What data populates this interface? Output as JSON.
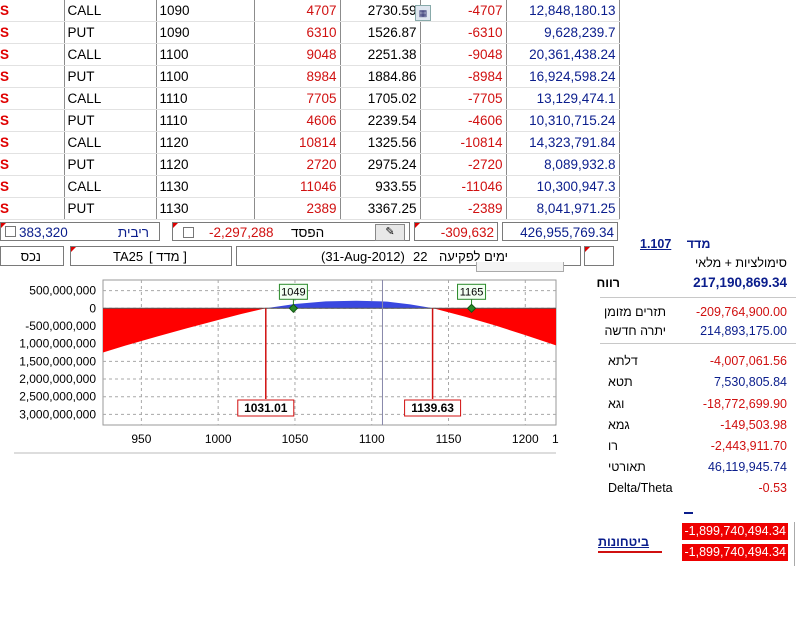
{
  "rows": [
    {
      "type": "CALL",
      "strike": "1090",
      "qty": "4707",
      "price": "2730.59",
      "neg_qty": "-4707",
      "value": "12,848,180.13"
    },
    {
      "type": "PUT",
      "strike": "1090",
      "qty": "6310",
      "price": "1526.87",
      "neg_qty": "-6310",
      "value": "9,628,239.7"
    },
    {
      "type": "CALL",
      "strike": "1100",
      "qty": "9048",
      "price": "2251.38",
      "neg_qty": "-9048",
      "value": "20,361,438.24"
    },
    {
      "type": "PUT",
      "strike": "1100",
      "qty": "8984",
      "price": "1884.86",
      "neg_qty": "-8984",
      "value": "16,924,598.24"
    },
    {
      "type": "CALL",
      "strike": "1110",
      "qty": "7705",
      "price": "1705.02",
      "neg_qty": "-7705",
      "value": "13,129,474.1"
    },
    {
      "type": "PUT",
      "strike": "1110",
      "qty": "4606",
      "price": "2239.54",
      "neg_qty": "-4606",
      "value": "10,310,715.24"
    },
    {
      "type": "CALL",
      "strike": "1120",
      "qty": "10814",
      "price": "1325.56",
      "neg_qty": "-10814",
      "value": "14,323,791.84"
    },
    {
      "type": "PUT",
      "strike": "1120",
      "qty": "2720",
      "price": "2975.24",
      "neg_qty": "-2720",
      "value": "8,089,932.8"
    },
    {
      "type": "CALL",
      "strike": "1130",
      "qty": "11046",
      "price": "933.55",
      "neg_qty": "-11046",
      "value": "10,300,947.3"
    },
    {
      "type": "PUT",
      "strike": "1130",
      "qty": "2389",
      "price": "3367.25",
      "neg_qty": "-2389",
      "value": "8,041,971.25"
    }
  ],
  "row_prefix": "S",
  "summary": {
    "interest_value": "383,320",
    "interest_label": "ריבית",
    "loss_value": "-2,297,288",
    "loss_label": "הפסד",
    "neg_total": "-309,632",
    "total_value": "426,955,769.34"
  },
  "header": {
    "assets_label": "נכס",
    "index_name": "TA25",
    "index_label": "[ מדד ]",
    "expiry_date": "(31-Aug-2012)",
    "days_to_expiry": "22",
    "days_label": "ימים לפקיעה"
  },
  "chart_data": {
    "type": "area",
    "y_tick_labels": [
      "500,000,000",
      "0",
      "-500,000,000",
      "1,000,000,000",
      "1,500,000,000",
      "2,000,000,000",
      "2,500,000,000",
      "3,000,000,000"
    ],
    "y_ticks": [
      500000000,
      0,
      -500000000,
      -1000000000,
      -1500000000,
      -2000000000,
      -2500000000,
      -3000000000
    ],
    "x_ticks": [
      950,
      1000,
      1050,
      1100,
      1150,
      1200
    ],
    "xlim": [
      925,
      1220
    ],
    "ylim": [
      -3300000000,
      800000000
    ],
    "profit_curve": {
      "x": [
        925,
        940,
        960,
        980,
        1000,
        1015,
        1031,
        1050,
        1070,
        1090,
        1110,
        1125,
        1140,
        1160,
        1180,
        1200,
        1220
      ],
      "y": [
        -1250000000,
        -1050000000,
        -800000000,
        -560000000,
        -330000000,
        -160000000,
        0,
        120000000,
        195000000,
        215000000,
        190000000,
        110000000,
        0,
        -230000000,
        -480000000,
        -760000000,
        -1050000000
      ]
    },
    "current_index": 1107,
    "breakeven": [
      {
        "x": 1031.01,
        "label": "1031.01"
      },
      {
        "x": 1139.63,
        "label": "1139.63"
      }
    ],
    "markers": [
      {
        "x": 1049,
        "label": "1049"
      },
      {
        "x": 1165,
        "label": "1165"
      }
    ],
    "colors": {
      "loss": "#ff0000",
      "profit": "#3a48e0",
      "marker": "#2a8a2a"
    }
  },
  "right_panel": {
    "index_label": "מדד",
    "index_value": "1.107",
    "sims_label": "סימולציות + מלאי",
    "profit_label": "רווח",
    "profit_value": "217,190,869.34",
    "cash_flow_label": "תזרים מזומן",
    "cash_flow_value": "-209,764,900.00",
    "new_balance_label": "יתרה חדשה",
    "new_balance_value": "214,893,175.00",
    "greeks": [
      {
        "label": "דלתא",
        "value": "-4,007,061.56",
        "sign": "neg"
      },
      {
        "label": "תטא",
        "value": "7,530,805.84",
        "sign": "pos"
      },
      {
        "label": "וגא",
        "value": "-18,772,699.90",
        "sign": "neg"
      },
      {
        "label": "גמא",
        "value": "-149,503.98",
        "sign": "neg"
      },
      {
        "label": "רו",
        "value": "-2,443,911.70",
        "sign": "neg"
      },
      {
        "label": "תאורטי",
        "value": "46,119,945.74",
        "sign": "pos"
      },
      {
        "label": "Delta/Theta",
        "value": "-0.53",
        "sign": "neg"
      }
    ],
    "hedges_label": "ביטחונות",
    "hedge_value_1": "-1,899,740,494.34",
    "hedge_value_2": "-1,899,740,494.34"
  }
}
